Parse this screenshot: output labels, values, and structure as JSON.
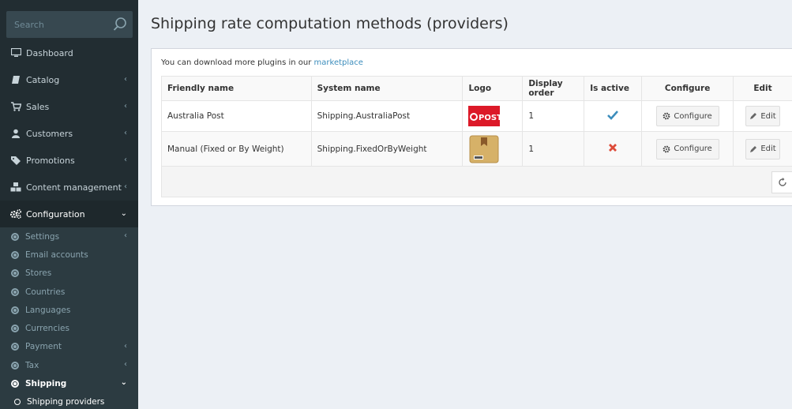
{
  "search": {
    "placeholder": "Search"
  },
  "sidebar": {
    "items": [
      {
        "label": "Dashboard"
      },
      {
        "label": "Catalog"
      },
      {
        "label": "Sales"
      },
      {
        "label": "Customers"
      },
      {
        "label": "Promotions"
      },
      {
        "label": "Content management"
      },
      {
        "label": "Configuration"
      }
    ],
    "config_sub": [
      {
        "label": "Settings"
      },
      {
        "label": "Email accounts"
      },
      {
        "label": "Stores"
      },
      {
        "label": "Countries"
      },
      {
        "label": "Languages"
      },
      {
        "label": "Currencies"
      },
      {
        "label": "Payment"
      },
      {
        "label": "Tax"
      },
      {
        "label": "Shipping"
      }
    ],
    "shipping_sub": [
      {
        "label": "Shipping providers"
      }
    ]
  },
  "page": {
    "title": "Shipping rate computation methods (providers)",
    "note_prefix": "You can download more plugins in our",
    "note_link": "marketplace"
  },
  "table": {
    "headers": [
      "Friendly name",
      "System name",
      "Logo",
      "Display order",
      "Is active",
      "Configure",
      "Edit"
    ],
    "rows": [
      {
        "friendly_name": "Australia Post",
        "system_name": "Shipping.AustraliaPost",
        "logo_text": "POST",
        "display_order": "1",
        "is_active": true,
        "configure": "Configure",
        "edit": "Edit"
      },
      {
        "friendly_name": "Manual (Fixed or By Weight)",
        "system_name": "Shipping.FixedOrByWeight",
        "logo_text": "",
        "display_order": "1",
        "is_active": false,
        "configure": "Configure",
        "edit": "Edit"
      }
    ]
  },
  "colors": {
    "sidebar_bg": "#222d32",
    "link": "#3c8dbc",
    "active_check": "#3c8dbc",
    "inactive_x": "#dd4b39",
    "auspost_red": "#dc1928"
  }
}
